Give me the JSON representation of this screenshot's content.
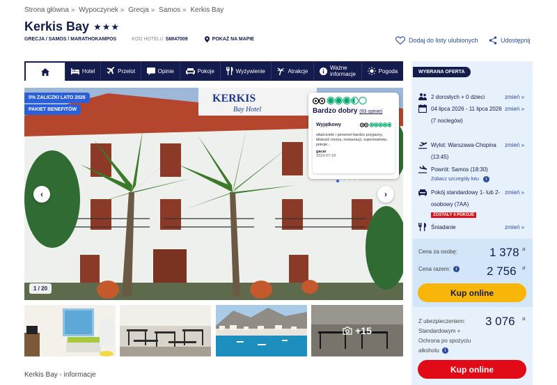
{
  "breadcrumb": [
    "Strona główna",
    "Wypoczynek",
    "Grecja",
    "Samos",
    "Kerkis Bay"
  ],
  "hotel": {
    "name": "Kerkis Bay",
    "stars": "★★★",
    "location": "GRECJA / SAMOS / MARATHOKAMPOS",
    "code_label": "KOD HOTELU",
    "code": "SMI47009",
    "map_link": "POKAŻ NA MAPIE"
  },
  "actions": {
    "favorite": "Dodaj do listy ulubionych",
    "share": "Udostępnij"
  },
  "nav": {
    "items": [
      {
        "label": ""
      },
      {
        "label": "Hotel"
      },
      {
        "label": "Przelot"
      },
      {
        "label": "Opinie"
      },
      {
        "label": "Pokoje"
      },
      {
        "label": "Wyżywienie"
      },
      {
        "label": "Atrakcje"
      },
      {
        "label1": "Ważne",
        "label2": "informacje"
      },
      {
        "label": "Pogoda"
      }
    ]
  },
  "gallery": {
    "badge_1": "5% ZALICZKI LATO 2026",
    "badge_2": "PAKIET BENEFITÓW",
    "counter": "1 / 20",
    "more": "+15",
    "sign_text": "KERKIS",
    "sign_sub": "Bay Hotel"
  },
  "tripadvisor": {
    "rating_bubbles": 3.5,
    "rating_text": "Bardzo dobry",
    "reviews": "(93 opinie)",
    "review_title": "Wyjątkowy",
    "review_bubbles": 5,
    "review_text": "właściciele i personel bardzo przyjazny, bliskość morza, restauracji, supermarketu. pokoje...",
    "author": "gacar",
    "date": "2019-07-18"
  },
  "info_title": "Kerkis Bay - informacje",
  "offer": {
    "header": "WYBRANA OFERTA",
    "change": "zmień »",
    "persons": "2 dorosłych + 0 dzieci",
    "dates": "04 lipca 2026 - 11 lipca 2026",
    "nights": "(7 nocy)",
    "nights_full": "(7 noclegów)",
    "departure": "Wylot: Warszawa-Chopina (13:45)",
    "return": "Powrót: Samos (18:30)",
    "flight_details": "Zobacz szczegóły lotu",
    "room": "Pokój standardowy 1- lub 2-osobowy (7AA)",
    "rooms_left": "ZOSTAŁY 4 POKOJE",
    "board": "Śniadanie"
  },
  "prices": {
    "per_person_label": "Cena za osobę:",
    "per_person": "1 378",
    "total_label": "Cena razem:",
    "total": "2 756",
    "currency": "zł",
    "buy": "Kup online",
    "insurance_text": "Z ubezpieczeniem: Standardowym + Ochrona po spożyciu alkoholu",
    "insurance_price": "3 076",
    "buy2": "Kup online"
  },
  "colors": {
    "navy": "#141b4d",
    "blue": "#2b5fd9",
    "yellow": "#f8b50a",
    "red": "#e10a17",
    "tripadvisor_green": "#00aa6c"
  }
}
